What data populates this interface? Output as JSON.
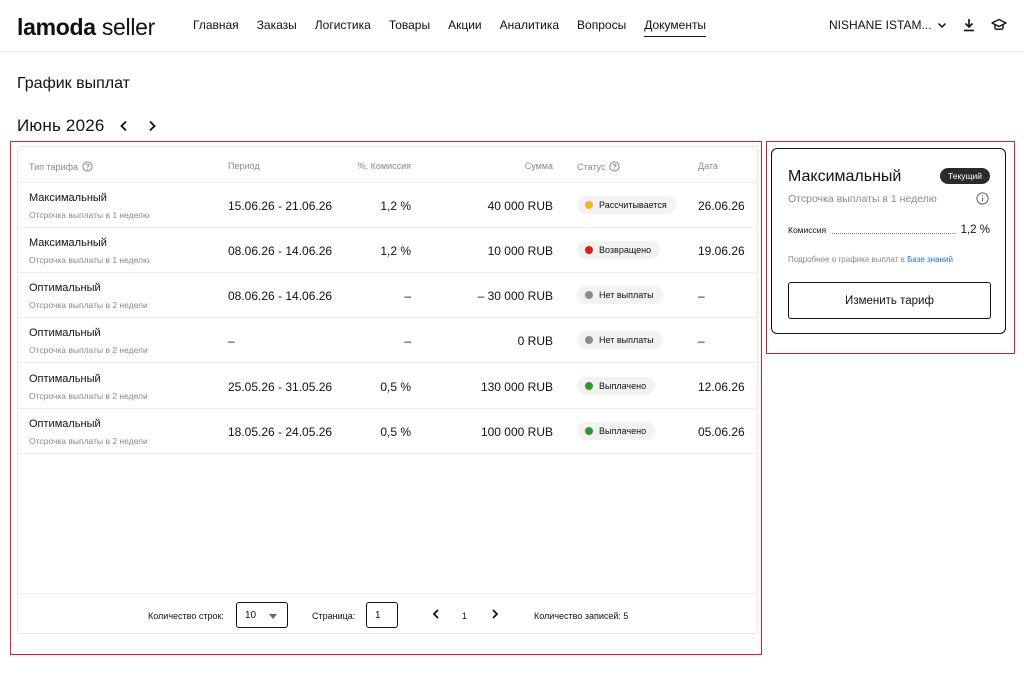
{
  "header": {
    "logo_brand": "lamoda",
    "logo_suffix": "seller",
    "nav": [
      {
        "label": "Главная"
      },
      {
        "label": "Заказы"
      },
      {
        "label": "Логистика"
      },
      {
        "label": "Товары"
      },
      {
        "label": "Акции"
      },
      {
        "label": "Аналитика"
      },
      {
        "label": "Вопросы"
      },
      {
        "label": "Документы",
        "active": true
      }
    ],
    "account_name": "NISHANE ISTAM...",
    "icons": [
      "download-icon",
      "graduation-cap-icon"
    ]
  },
  "page": {
    "title": "График выплат",
    "month": "Июнь 2026"
  },
  "table": {
    "headers": {
      "tariff": "Тип тарифа",
      "period": "Период",
      "commission": "%, Комиссия",
      "sum": "Сумма",
      "status": "Статус",
      "date": "Дата"
    },
    "rows": [
      {
        "tariff": "Максимальный",
        "tariff_sub": "Отсрочка выплаты в 1 неделю",
        "period": "15.06.26 - 21.06.26",
        "commission": "1,2 %",
        "sum": "40 000  RUB",
        "status": "Рассчитывается",
        "status_color": "#f0b429",
        "date": "26.06.26"
      },
      {
        "tariff": "Максимальный",
        "tariff_sub": "Отсрочка выплаты в 1 неделю",
        "period": "08.06.26 - 14.06.26",
        "commission": "1,2 %",
        "sum": "10 000 RUB",
        "status": "Возвращено",
        "status_color": "#d6231b",
        "date": "19.06.26"
      },
      {
        "tariff": "Оптимальный",
        "tariff_sub": "Отсрочка выплаты в 2 недели",
        "period": "08.06.26 - 14.06.26",
        "commission": "–",
        "sum": "– 30 000 RUB",
        "status": "Нет выплаты",
        "status_color": "#8c8c8c",
        "date": "–"
      },
      {
        "tariff": "Оптимальный",
        "tariff_sub": "Отсрочка выплаты в 2 недели",
        "period": "–",
        "commission": "–",
        "sum": "0 RUB",
        "status": "Нет выплаты",
        "status_color": "#8c8c8c",
        "date": "–"
      },
      {
        "tariff": "Оптимальный",
        "tariff_sub": "Отсрочка выплаты в 2 недели",
        "period": "25.05.26 - 31.05.26",
        "commission": "0,5 %",
        "sum": "130 000 RUB",
        "status": "Выплачено",
        "status_color": "#2e9a2e",
        "date": "12.06.26"
      },
      {
        "tariff": "Оптимальный",
        "tariff_sub": "Отсрочка выплаты в 2 недели",
        "period": "18.05.26 - 24.05.26",
        "commission": "0,5 %",
        "sum": "100 000 RUB",
        "status": "Выплачено",
        "status_color": "#2e9a2e",
        "date": "05.06.26"
      }
    ]
  },
  "pagination": {
    "rows_label": "Количество строк:",
    "rows_value": "10",
    "page_label": "Страница:",
    "page_input": "1",
    "page_current": "1",
    "records": "Количество записей: 5"
  },
  "tariff_card": {
    "name": "Максимальный",
    "badge": "Текущий",
    "subtitle": "Отсрочка выплаты в 1 неделю",
    "commission_label": "Комиссия",
    "commission_value": "1,2 %",
    "info_text": "Подробнее о графике выплат в",
    "info_link": "Базе знаний",
    "button": "Изменить тариф"
  },
  "highlight_color": "#e11d2a"
}
